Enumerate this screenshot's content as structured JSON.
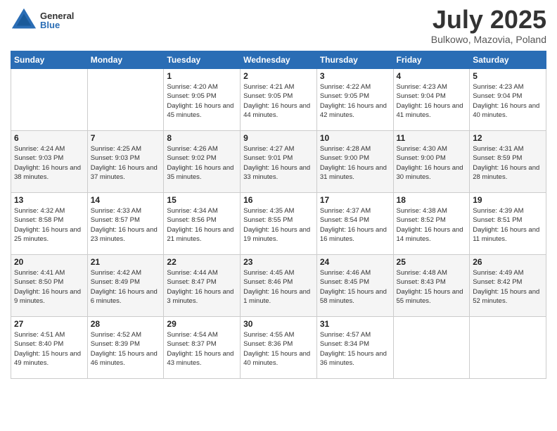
{
  "header": {
    "logo": {
      "general": "General",
      "blue": "Blue"
    },
    "title": "July 2025",
    "location": "Bulkowo, Mazovia, Poland"
  },
  "weekdays": [
    "Sunday",
    "Monday",
    "Tuesday",
    "Wednesday",
    "Thursday",
    "Friday",
    "Saturday"
  ],
  "weeks": [
    [
      null,
      null,
      {
        "day": "1",
        "sunrise": "Sunrise: 4:20 AM",
        "sunset": "Sunset: 9:05 PM",
        "daylight": "Daylight: 16 hours and 45 minutes."
      },
      {
        "day": "2",
        "sunrise": "Sunrise: 4:21 AM",
        "sunset": "Sunset: 9:05 PM",
        "daylight": "Daylight: 16 hours and 44 minutes."
      },
      {
        "day": "3",
        "sunrise": "Sunrise: 4:22 AM",
        "sunset": "Sunset: 9:05 PM",
        "daylight": "Daylight: 16 hours and 42 minutes."
      },
      {
        "day": "4",
        "sunrise": "Sunrise: 4:23 AM",
        "sunset": "Sunset: 9:04 PM",
        "daylight": "Daylight: 16 hours and 41 minutes."
      },
      {
        "day": "5",
        "sunrise": "Sunrise: 4:23 AM",
        "sunset": "Sunset: 9:04 PM",
        "daylight": "Daylight: 16 hours and 40 minutes."
      }
    ],
    [
      {
        "day": "6",
        "sunrise": "Sunrise: 4:24 AM",
        "sunset": "Sunset: 9:03 PM",
        "daylight": "Daylight: 16 hours and 38 minutes."
      },
      {
        "day": "7",
        "sunrise": "Sunrise: 4:25 AM",
        "sunset": "Sunset: 9:03 PM",
        "daylight": "Daylight: 16 hours and 37 minutes."
      },
      {
        "day": "8",
        "sunrise": "Sunrise: 4:26 AM",
        "sunset": "Sunset: 9:02 PM",
        "daylight": "Daylight: 16 hours and 35 minutes."
      },
      {
        "day": "9",
        "sunrise": "Sunrise: 4:27 AM",
        "sunset": "Sunset: 9:01 PM",
        "daylight": "Daylight: 16 hours and 33 minutes."
      },
      {
        "day": "10",
        "sunrise": "Sunrise: 4:28 AM",
        "sunset": "Sunset: 9:00 PM",
        "daylight": "Daylight: 16 hours and 31 minutes."
      },
      {
        "day": "11",
        "sunrise": "Sunrise: 4:30 AM",
        "sunset": "Sunset: 9:00 PM",
        "daylight": "Daylight: 16 hours and 30 minutes."
      },
      {
        "day": "12",
        "sunrise": "Sunrise: 4:31 AM",
        "sunset": "Sunset: 8:59 PM",
        "daylight": "Daylight: 16 hours and 28 minutes."
      }
    ],
    [
      {
        "day": "13",
        "sunrise": "Sunrise: 4:32 AM",
        "sunset": "Sunset: 8:58 PM",
        "daylight": "Daylight: 16 hours and 25 minutes."
      },
      {
        "day": "14",
        "sunrise": "Sunrise: 4:33 AM",
        "sunset": "Sunset: 8:57 PM",
        "daylight": "Daylight: 16 hours and 23 minutes."
      },
      {
        "day": "15",
        "sunrise": "Sunrise: 4:34 AM",
        "sunset": "Sunset: 8:56 PM",
        "daylight": "Daylight: 16 hours and 21 minutes."
      },
      {
        "day": "16",
        "sunrise": "Sunrise: 4:35 AM",
        "sunset": "Sunset: 8:55 PM",
        "daylight": "Daylight: 16 hours and 19 minutes."
      },
      {
        "day": "17",
        "sunrise": "Sunrise: 4:37 AM",
        "sunset": "Sunset: 8:54 PM",
        "daylight": "Daylight: 16 hours and 16 minutes."
      },
      {
        "day": "18",
        "sunrise": "Sunrise: 4:38 AM",
        "sunset": "Sunset: 8:52 PM",
        "daylight": "Daylight: 16 hours and 14 minutes."
      },
      {
        "day": "19",
        "sunrise": "Sunrise: 4:39 AM",
        "sunset": "Sunset: 8:51 PM",
        "daylight": "Daylight: 16 hours and 11 minutes."
      }
    ],
    [
      {
        "day": "20",
        "sunrise": "Sunrise: 4:41 AM",
        "sunset": "Sunset: 8:50 PM",
        "daylight": "Daylight: 16 hours and 9 minutes."
      },
      {
        "day": "21",
        "sunrise": "Sunrise: 4:42 AM",
        "sunset": "Sunset: 8:49 PM",
        "daylight": "Daylight: 16 hours and 6 minutes."
      },
      {
        "day": "22",
        "sunrise": "Sunrise: 4:44 AM",
        "sunset": "Sunset: 8:47 PM",
        "daylight": "Daylight: 16 hours and 3 minutes."
      },
      {
        "day": "23",
        "sunrise": "Sunrise: 4:45 AM",
        "sunset": "Sunset: 8:46 PM",
        "daylight": "Daylight: 16 hours and 1 minute."
      },
      {
        "day": "24",
        "sunrise": "Sunrise: 4:46 AM",
        "sunset": "Sunset: 8:45 PM",
        "daylight": "Daylight: 15 hours and 58 minutes."
      },
      {
        "day": "25",
        "sunrise": "Sunrise: 4:48 AM",
        "sunset": "Sunset: 8:43 PM",
        "daylight": "Daylight: 15 hours and 55 minutes."
      },
      {
        "day": "26",
        "sunrise": "Sunrise: 4:49 AM",
        "sunset": "Sunset: 8:42 PM",
        "daylight": "Daylight: 15 hours and 52 minutes."
      }
    ],
    [
      {
        "day": "27",
        "sunrise": "Sunrise: 4:51 AM",
        "sunset": "Sunset: 8:40 PM",
        "daylight": "Daylight: 15 hours and 49 minutes."
      },
      {
        "day": "28",
        "sunrise": "Sunrise: 4:52 AM",
        "sunset": "Sunset: 8:39 PM",
        "daylight": "Daylight: 15 hours and 46 minutes."
      },
      {
        "day": "29",
        "sunrise": "Sunrise: 4:54 AM",
        "sunset": "Sunset: 8:37 PM",
        "daylight": "Daylight: 15 hours and 43 minutes."
      },
      {
        "day": "30",
        "sunrise": "Sunrise: 4:55 AM",
        "sunset": "Sunset: 8:36 PM",
        "daylight": "Daylight: 15 hours and 40 minutes."
      },
      {
        "day": "31",
        "sunrise": "Sunrise: 4:57 AM",
        "sunset": "Sunset: 8:34 PM",
        "daylight": "Daylight: 15 hours and 36 minutes."
      },
      null,
      null
    ]
  ]
}
